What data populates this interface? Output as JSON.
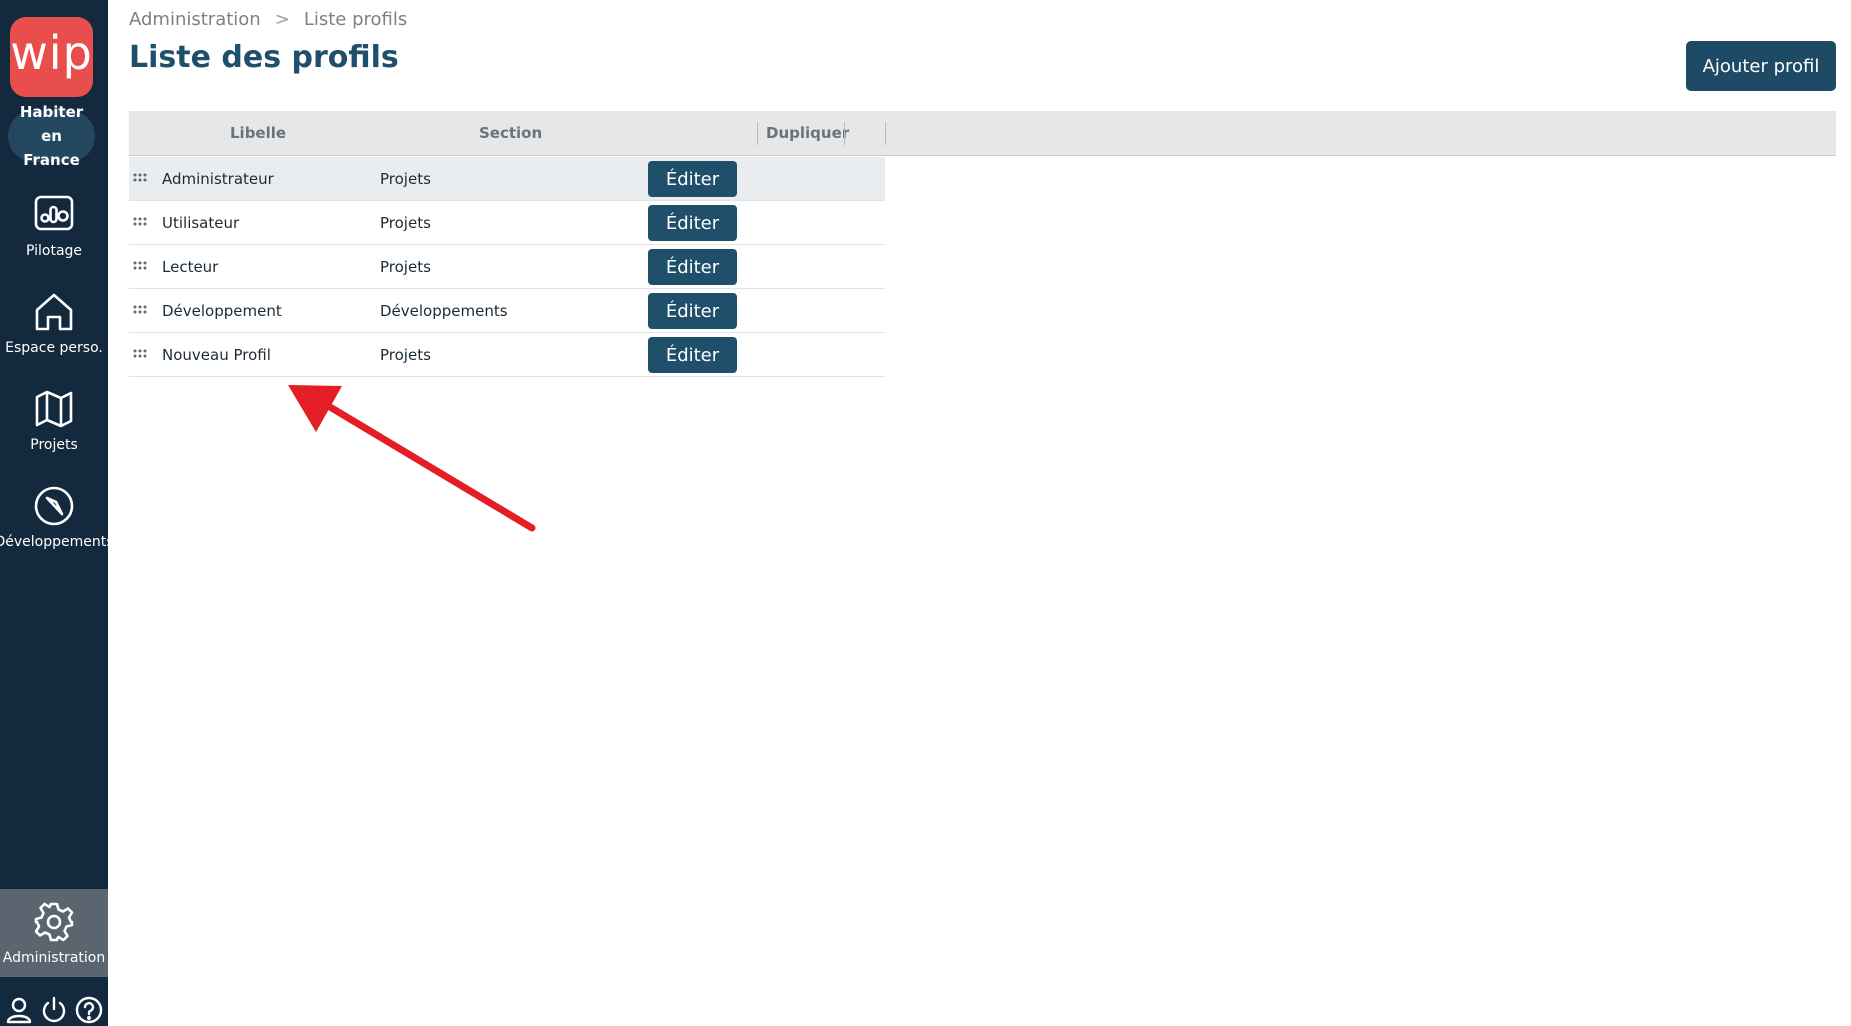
{
  "sidebar": {
    "logo_text": "wip",
    "org": {
      "line1": "Habiter en",
      "line2": "France"
    },
    "items": [
      {
        "label": "Pilotage",
        "icon": "chart-icon"
      },
      {
        "label": "Espace perso.",
        "icon": "home-icon"
      },
      {
        "label": "Projets",
        "icon": "map-icon"
      },
      {
        "label": "Développements",
        "icon": "compass-icon"
      },
      {
        "label": "Administration",
        "icon": "gear-icon"
      }
    ],
    "bottom_icons": [
      "user-icon",
      "power-icon",
      "help-icon"
    ]
  },
  "breadcrumb": {
    "root": "Administration",
    "separator": ">",
    "current": "Liste profils"
  },
  "page": {
    "title": "Liste des profils",
    "add_button": "Ajouter profil"
  },
  "table": {
    "columns": [
      "Libelle",
      "Section",
      "Dupliquer"
    ],
    "rows": [
      {
        "libelle": "Administrateur",
        "section": "Projets",
        "action": "Éditer"
      },
      {
        "libelle": "Utilisateur",
        "section": "Projets",
        "action": "Éditer"
      },
      {
        "libelle": "Lecteur",
        "section": "Projets",
        "action": "Éditer"
      },
      {
        "libelle": "Développement",
        "section": "Développements",
        "action": "Éditer"
      },
      {
        "libelle": "Nouveau Profil",
        "section": "Projets",
        "action": "Éditer"
      }
    ]
  },
  "colors": {
    "sidebar": "#13293d",
    "logo": "#e84e4c",
    "primary": "#1f4f6b",
    "arrow": "#e31e24"
  }
}
